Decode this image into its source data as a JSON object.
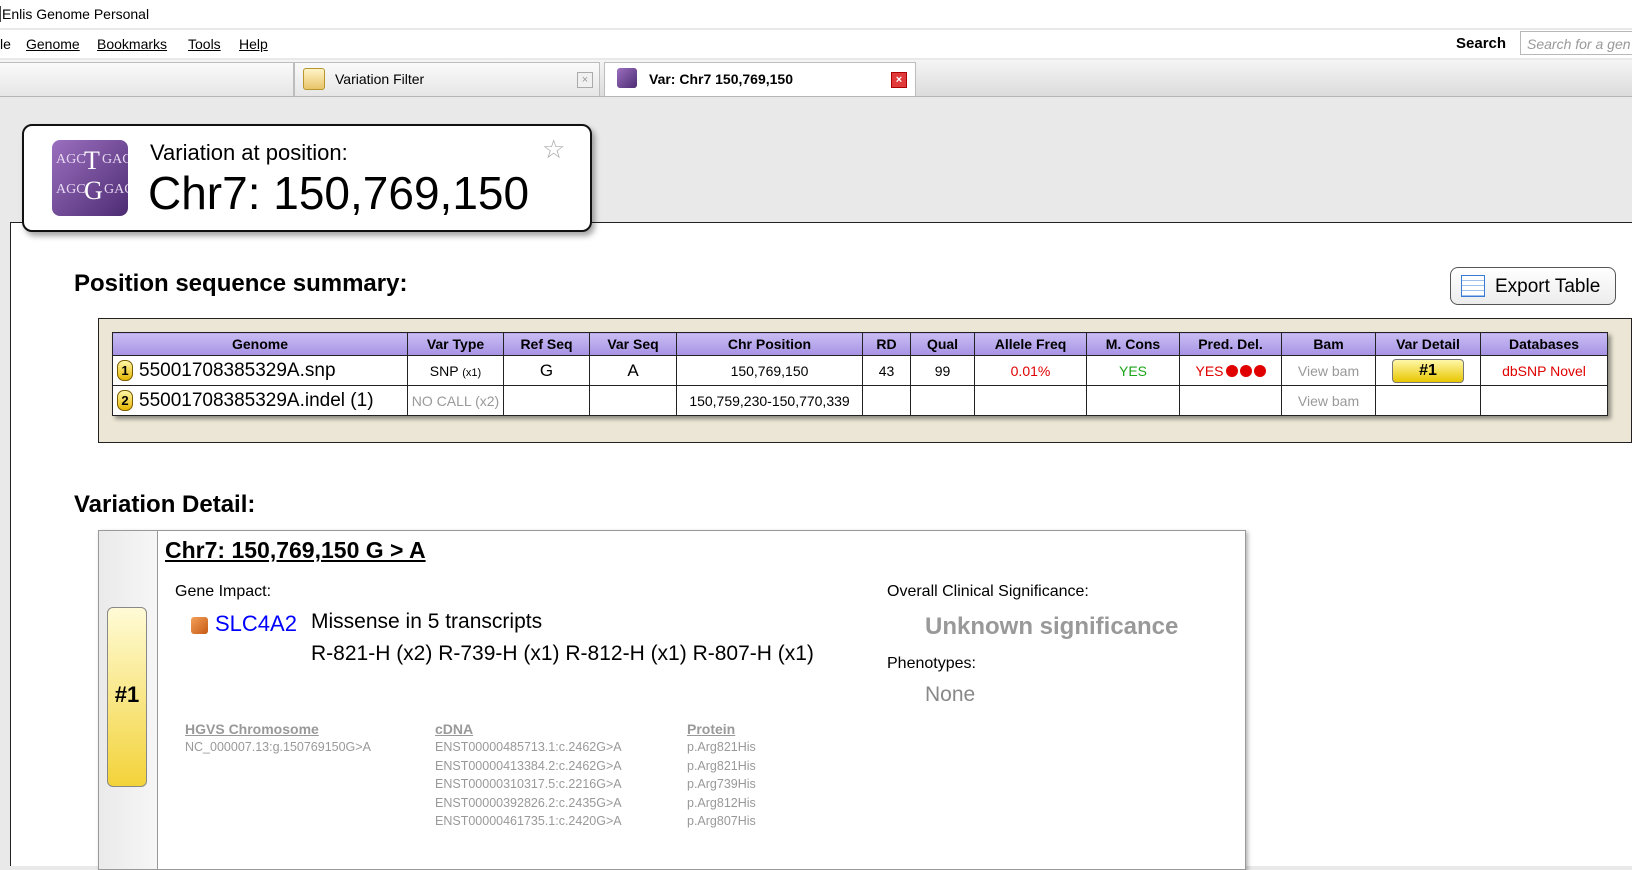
{
  "app": {
    "title": "Enlis Genome Personal"
  },
  "menu": {
    "file": "le",
    "genome": "Genome",
    "bookmarks": "Bookmarks",
    "tools": "Tools",
    "help": "Help"
  },
  "search": {
    "label": "Search",
    "placeholder": "Search for a gen"
  },
  "tabs": [
    {
      "label": "Variation Filter",
      "icon": "filter-icon"
    },
    {
      "label": "Var: Chr7  150,769,150",
      "icon": "variation-icon",
      "active": true
    }
  ],
  "header": {
    "label": "Variation at position:",
    "position": "Chr7: 150,769,150"
  },
  "logo": {
    "row1": "AGC",
    "row2": "AGC",
    "big1": "T",
    "big2": "G",
    "tail": "GAC"
  },
  "summary": {
    "title": "Position sequence summary:",
    "export_label": "Export Table",
    "columns": [
      "Genome",
      "Var Type",
      "Ref Seq",
      "Var Seq",
      "Chr Position",
      "RD",
      "Qual",
      "Allele Freq",
      "M. Cons",
      "Pred. Del.",
      "Bam",
      "Var Detail",
      "Databases"
    ],
    "rows": [
      {
        "num": "1",
        "genome": "55001708385329A.snp",
        "var_type": "SNP",
        "var_type_count": "(x1)",
        "ref_seq": "G",
        "var_seq": "A",
        "chr_position": "150,769,150",
        "rd": "43",
        "qual": "99",
        "allele_freq": "0.01%",
        "m_cons": "YES",
        "pred_del": "YES",
        "bam": "View bam",
        "var_detail": "#1",
        "databases": "dbSNP Novel"
      },
      {
        "num": "2",
        "genome": "55001708385329A.indel (1)",
        "var_type": "NO CALL (x2)",
        "ref_seq": "",
        "var_seq": "",
        "chr_position": "150,759,230-150,770,339",
        "rd": "",
        "qual": "",
        "allele_freq": "",
        "m_cons": "",
        "pred_del": "",
        "bam": "View bam",
        "var_detail": "",
        "databases": ""
      }
    ],
    "colors": {
      "header": "#a792e4",
      "alert": "#e00000",
      "ok": "#1aa51a"
    }
  },
  "detail": {
    "title": "Variation Detail:",
    "tag": "#1",
    "heading": "Chr7: 150,769,150  G > A",
    "gene_impact_label": "Gene Impact:",
    "gene": "SLC4A2",
    "impact": "Missense in 5 transcripts",
    "changes": "R-821-H (x2)  R-739-H (x1)  R-812-H (x1)  R-807-H (x1)",
    "clinical_label": "Overall Clinical Significance:",
    "clinical_value": "Unknown significance",
    "phenotypes_label": "Phenotypes:",
    "phenotypes_value": "None",
    "hgvs_chrom_label": "HGVS Chromosome",
    "hgvs_chrom_value": "NC_000007.13:g.150769150G>A",
    "cdna_label": "cDNA",
    "cdna": [
      "ENST00000485713.1:c.2462G>A",
      "ENST00000413384.2:c.2462G>A",
      "ENST00000310317.5:c.2216G>A",
      "ENST00000392826.2:c.2435G>A",
      "ENST00000461735.1:c.2420G>A"
    ],
    "protein_label": "Protein",
    "protein": [
      "p.Arg821His",
      "p.Arg821His",
      "p.Arg739His",
      "p.Arg812His",
      "p.Arg807His"
    ]
  }
}
